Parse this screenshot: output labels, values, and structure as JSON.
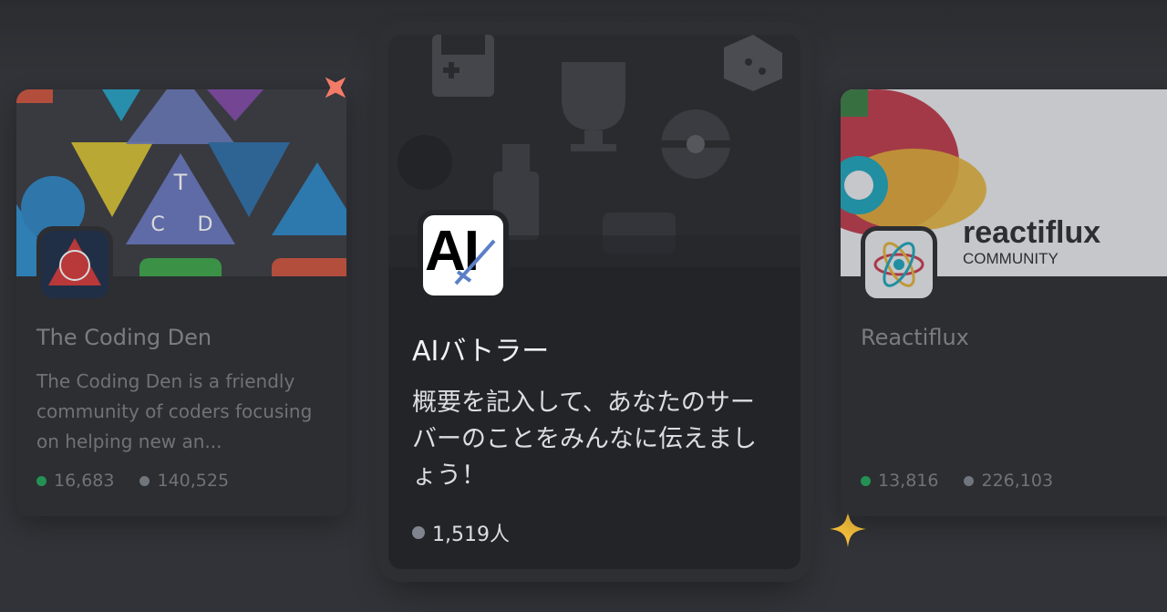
{
  "cards": [
    {
      "name": "The Coding Den",
      "description": "The Coding Den is a friendly community of coders focusing on helping new an...",
      "online": "16,683",
      "members": "140,525"
    },
    {
      "name": "AIバトラー",
      "description": "概要を記入して、あなたのサーバーのことをみんなに伝えましょう！",
      "members": "1,519人",
      "avatar_text": "AI"
    },
    {
      "name": "Reactiflux",
      "online": "13,816",
      "members": "226,103",
      "banner_title": "reactiflux",
      "banner_subtitle": "COMMUNITY"
    }
  ],
  "avatar_letters": {
    "top": "T",
    "left": "C",
    "right": "D"
  },
  "colors": {
    "background": "#313338",
    "card": "#2b2d31",
    "online_dot": "#23a559",
    "member_dot": "#80848e",
    "sparkle_orange": "#f47b67",
    "sparkle_yellow": "#f9c23c"
  }
}
